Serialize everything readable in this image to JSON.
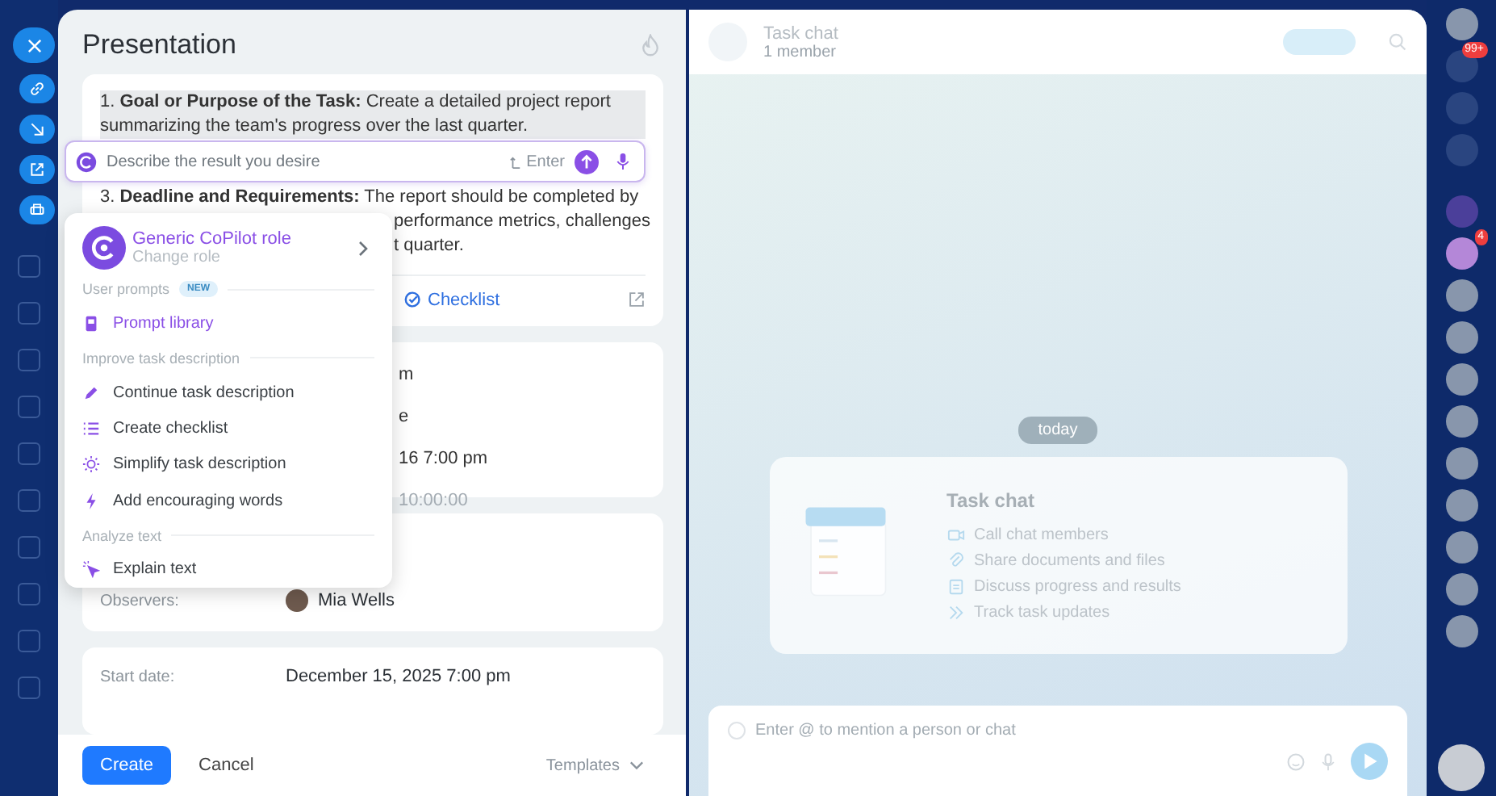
{
  "task": {
    "title": "Presentation",
    "description": {
      "line_1": {
        "number": "1.",
        "label": "Goal or Purpose of the Task:",
        "text": "Create a detailed project report summarizing the team's progress over the last quarter."
      },
      "line_3": {
        "number": "3.",
        "label": "Deadline and Requirements:",
        "text": "The report should be completed by"
      },
      "fragments": [
        "performance metrics, challenges",
        "t quarter."
      ],
      "checklist_link": "Checklist"
    },
    "details_fragments": [
      {
        "text": "m",
        "muted": false
      },
      {
        "text": "e",
        "muted": false
      },
      {
        "text": "16 7:00 pm",
        "muted": false
      },
      {
        "text": "10:00:00",
        "muted": true
      }
    ],
    "observers": {
      "label": "Observers:",
      "name": "Mia Wells"
    },
    "start_date": {
      "label": "Start date:",
      "value": "December 15, 2025 7:00 pm"
    },
    "footer": {
      "create": "Create",
      "cancel": "Cancel",
      "templates": "Templates"
    }
  },
  "copilot": {
    "placeholder": "Describe the result you desire",
    "enter_hint": "Enter",
    "role": {
      "title": "Generic CoPilot role",
      "subtitle": "Change role"
    },
    "sections": [
      {
        "title": "User prompts",
        "badge": "NEW",
        "items": [
          {
            "label": "Prompt library",
            "kind": "library",
            "accent": true
          }
        ]
      },
      {
        "title": "Improve task description",
        "items": [
          {
            "label": "Continue task description",
            "kind": "pen",
            "accent": false
          },
          {
            "label": "Create checklist",
            "kind": "list",
            "accent": false
          },
          {
            "label": "Simplify task description",
            "kind": "sun",
            "accent": false
          },
          {
            "label": "Add encouraging words",
            "kind": "bolt",
            "accent": false
          }
        ]
      },
      {
        "title": "Analyze text",
        "items": [
          {
            "label": "Explain text",
            "kind": "cursor",
            "accent": false
          }
        ]
      }
    ]
  },
  "chat": {
    "title": "Task chat",
    "members": "1 member",
    "date": "today",
    "card": {
      "title": "Task chat",
      "features": [
        {
          "label": "Call chat members",
          "kind": "camera"
        },
        {
          "label": "Share documents and files",
          "kind": "clip"
        },
        {
          "label": "Discuss progress and results",
          "kind": "doc"
        },
        {
          "label": "Track task updates",
          "kind": "forward"
        }
      ]
    },
    "input_placeholder": "Enter @ to mention a person or chat"
  },
  "right_bar": {
    "notifications_badge": "99+",
    "contact_badge": "4"
  }
}
